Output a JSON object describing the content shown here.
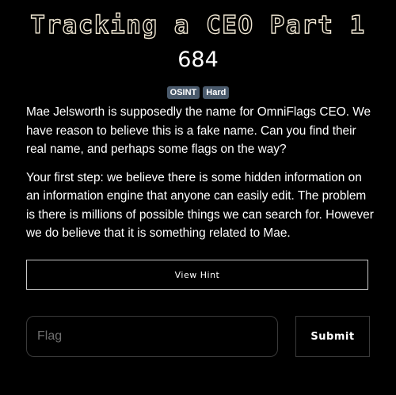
{
  "challenge": {
    "title": "Tracking a CEO Part 1",
    "value": "684",
    "tags": [
      "OSINT",
      "Hard"
    ],
    "description": [
      "Mae Jelsworth is supposedly the name for OmniFlags CEO. We have reason to believe this is a fake name. Can you find their real name, and perhaps some flags on the way?",
      "Your first step: we believe there is some hidden information on an information engine that anyone can easily edit. The problem is there is millions of possible things we can search for. However we do believe that it is something related to Mae."
    ]
  },
  "hint": {
    "button_label": "View Hint"
  },
  "submission": {
    "flag_placeholder": "Flag",
    "flag_value": "",
    "submit_label": "Submit"
  },
  "colors": {
    "background": "#000000",
    "title_outline": "#efe6d2",
    "tag_background": "#4a5a6c",
    "border": "#c8c8c8"
  }
}
